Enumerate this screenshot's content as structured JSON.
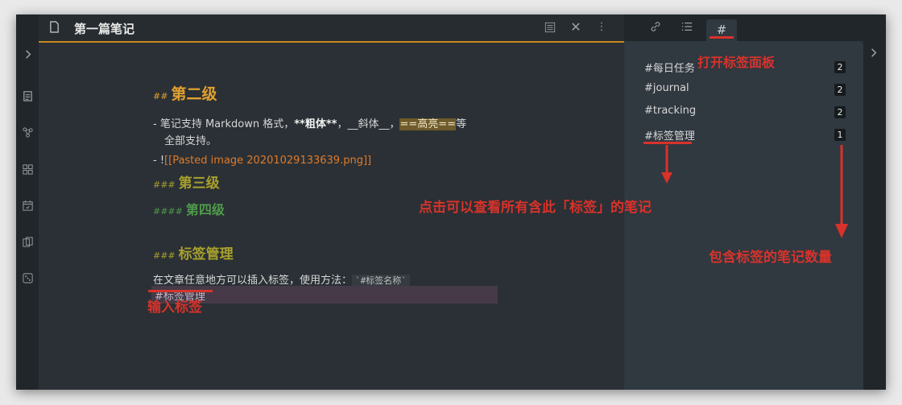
{
  "note": {
    "title": "第一篇笔记"
  },
  "editor": {
    "h2_hash": "##",
    "h2_text": "第二级",
    "bullet1_pre": "- 笔记支持 Markdown 格式，",
    "bullet1_bold": "**粗体**",
    "bullet1_sep": "，",
    "bullet1_italic": "__斜体__",
    "bullet1_sep2": "，",
    "bullet1_hl": "==高亮==",
    "bullet1_post": "等",
    "bullet1_cont": "全部支持。",
    "bullet2_pre": "- !",
    "bullet2_link": "[[Pasted image 20201029133639.png]]",
    "h3a_hash": "###",
    "h3a_text": "第三级",
    "h4_hash": "####",
    "h4_text": "第四级",
    "h3b_hash": "###",
    "h3b_text": "标签管理",
    "para": "在文章任意地方可以插入标签，使用方法：",
    "para_code": "`#标签名称`",
    "tag_line": "#标签管理"
  },
  "tags": {
    "items": [
      {
        "name": "#每日任务",
        "count": "2"
      },
      {
        "name": "#journal",
        "count": "2"
      },
      {
        "name": "#tracking",
        "count": "2"
      },
      {
        "name": "#标签管理",
        "count": "1"
      }
    ]
  },
  "annotations": {
    "open_tag_pane": "打开标签面板",
    "click_view": "点击可以查看所有含此「标签」的笔记",
    "count_note": "包含标签的笔记数量",
    "input_tag": "输入标签"
  },
  "icons": {
    "expand_left": "chevron-right-icon",
    "expand_right": "chevron-right-icon",
    "file": "file-icon",
    "reading_view": "book-open-icon",
    "close": "close-icon",
    "more": "more-vertical-icon",
    "backlinks": "link-icon",
    "outline": "list-icon",
    "tag_pane": "hash-icon"
  },
  "colors": {
    "accent": "#c8891a",
    "annotation": "#d8322a",
    "h2": "#e0a030",
    "h3": "#a8a02c",
    "h4": "#4f9a4b"
  }
}
